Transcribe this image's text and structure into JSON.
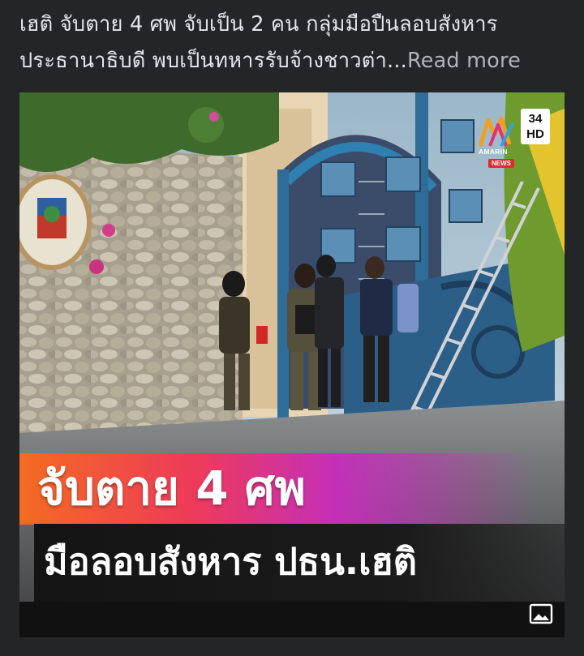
{
  "post": {
    "headline_line1": "เฮติ จับตาย 4 ศพ จับเป็น 2 คน กลุ่มมือปืนลอบสังหาร",
    "headline_line2": "ประธานาธิบดี พบเป็นทหารรับจ้างชาวต่า",
    "ellipsis": "...",
    "read_more": "Read more"
  },
  "media": {
    "banner_top_text": "จับตาย 4 ศพ",
    "banner_bottom_text": "มือลอบสังหาร ปธน.เฮติ",
    "channel_number": "34",
    "channel_hd": "HD",
    "brand_name": "AMARIN",
    "brand_tag": "NEWS",
    "image_icon": "image-gallery-icon"
  },
  "colors": {
    "background": "#242526",
    "text_primary": "#e4e6eb",
    "text_secondary": "#b0b3b8",
    "banner_gradient_start": "#f36b21",
    "banner_gradient_mid": "#ee3a5a",
    "banner_gradient_end": "#c42fb8",
    "brand_news_red": "#e02b2b"
  }
}
